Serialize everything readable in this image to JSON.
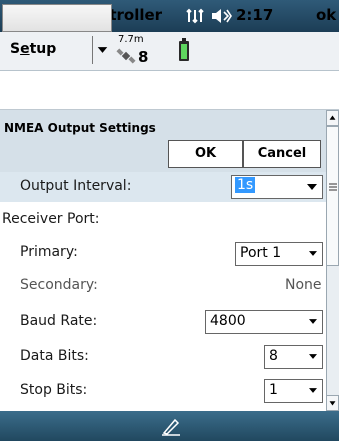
{
  "titlebar": {
    "title": "GPS Controller",
    "clock": "2:17",
    "ok": "ok",
    "icons": [
      "windows-start-icon",
      "connectivity-icon",
      "volume-icon"
    ]
  },
  "toolbar": {
    "menu_label": "Setup",
    "menu_mnemonic": "e",
    "distance": "7.7m",
    "satellites": "8",
    "icons": [
      "satellite-icon",
      "battery-icon"
    ]
  },
  "dialog": {
    "title": "NMEA Output Settings",
    "ok_label": "OK",
    "cancel_label": "Cancel"
  },
  "form": {
    "output_interval": {
      "label": "Output Interval:",
      "value": "1s"
    },
    "receiver_port_label": "Receiver Port:",
    "primary": {
      "label": "Primary:",
      "value": "Port 1"
    },
    "secondary": {
      "label": "Secondary:",
      "value": "None"
    },
    "baud_rate": {
      "label": "Baud Rate:",
      "value": "4800"
    },
    "data_bits": {
      "label": "Data Bits:",
      "value": "8"
    },
    "stop_bits": {
      "label": "Stop Bits:",
      "value": "1"
    }
  },
  "colors": {
    "titlebar": "#1c3d55",
    "dialog_header": "#d5e0e8",
    "selection": "#3399ff"
  }
}
